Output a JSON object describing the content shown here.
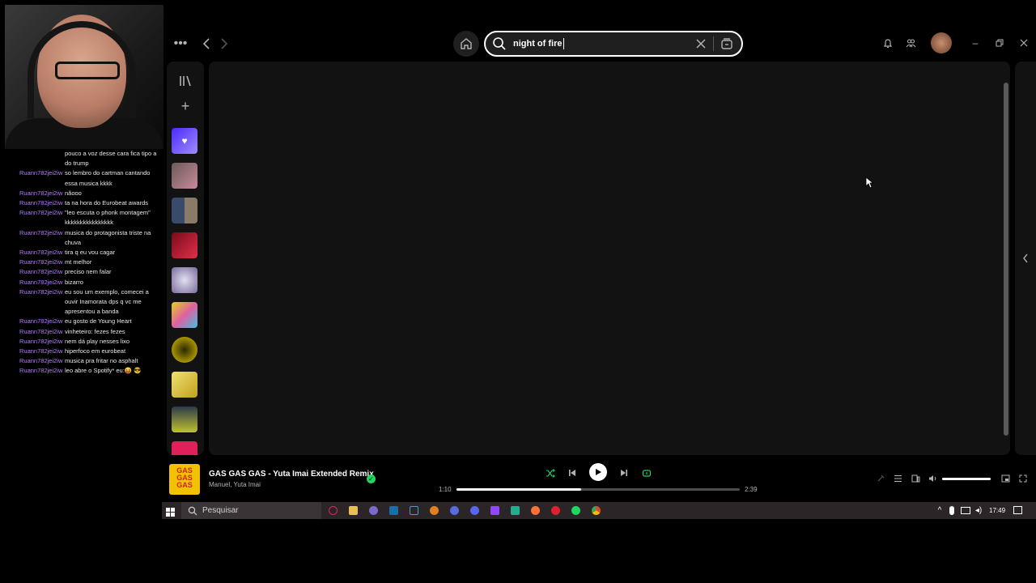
{
  "chat": [
    {
      "user": "",
      "text": "pouco a voz desse cara fica tipo a do trump"
    },
    {
      "user": "Ruann782jei2iw",
      "text": "so lembro do cartman cantando essa musica kkkk"
    },
    {
      "user": "Ruann782jei2iw",
      "text": "nãooo"
    },
    {
      "user": "Ruann782jei2iw",
      "text": "ta na hora do Eurobeat awards"
    },
    {
      "user": "Ruann782jei2iw",
      "text": "\"leo escuta o phonk montagem\" kkkkkkkkkkkkkkkk"
    },
    {
      "user": "Ruann782jei2iw",
      "text": "musica do protagonista triste na chuva"
    },
    {
      "user": "Ruann782jei2iw",
      "text": "tira q eu vou cagar"
    },
    {
      "user": "Ruann782jei2iw",
      "text": "mt melhor"
    },
    {
      "user": "Ruann782jei2iw",
      "text": "preciso nem falar"
    },
    {
      "user": "Ruann782jei2iw",
      "text": "bizarro"
    },
    {
      "user": "Ruann782jei2iw",
      "text": "eu sou um exemplo, comecei a ouvir Inamorata dps q vc me apresentou a banda"
    },
    {
      "user": "Ruann782jei2iw",
      "text": "eu gosto de Young Heart"
    },
    {
      "user": "Ruann782jei2iw",
      "text": "vinheteiro: fezes fezes"
    },
    {
      "user": "Ruann782jei2iw",
      "text": "nem dá play nesses lixo"
    },
    {
      "user": "Ruann782jei2iw",
      "text": "hiperfoco em eurobeat"
    },
    {
      "user": "Ruann782jei2iw",
      "text": "musica pra fritar no asphalt"
    },
    {
      "user": "Ruann782jei2iw",
      "text": "leo abre o Spotify* eu:😝 😎"
    }
  ],
  "search": {
    "query": "night of fire"
  },
  "now_playing": {
    "cover_text": "GAS GAS GAS",
    "title": "GAS GAS GAS - Yuta Imai Extended Remix",
    "artist": "Manuel, Yuta Imai",
    "elapsed": "1:10",
    "total": "2:39",
    "progress_fraction": 0.44,
    "volume_fraction": 1.0
  },
  "taskbar": {
    "search_label": "Pesquisar",
    "clock": "17:49"
  },
  "colors": {
    "accent": "#1ed760",
    "chat_user": "#b47cff",
    "panel": "#121212"
  }
}
